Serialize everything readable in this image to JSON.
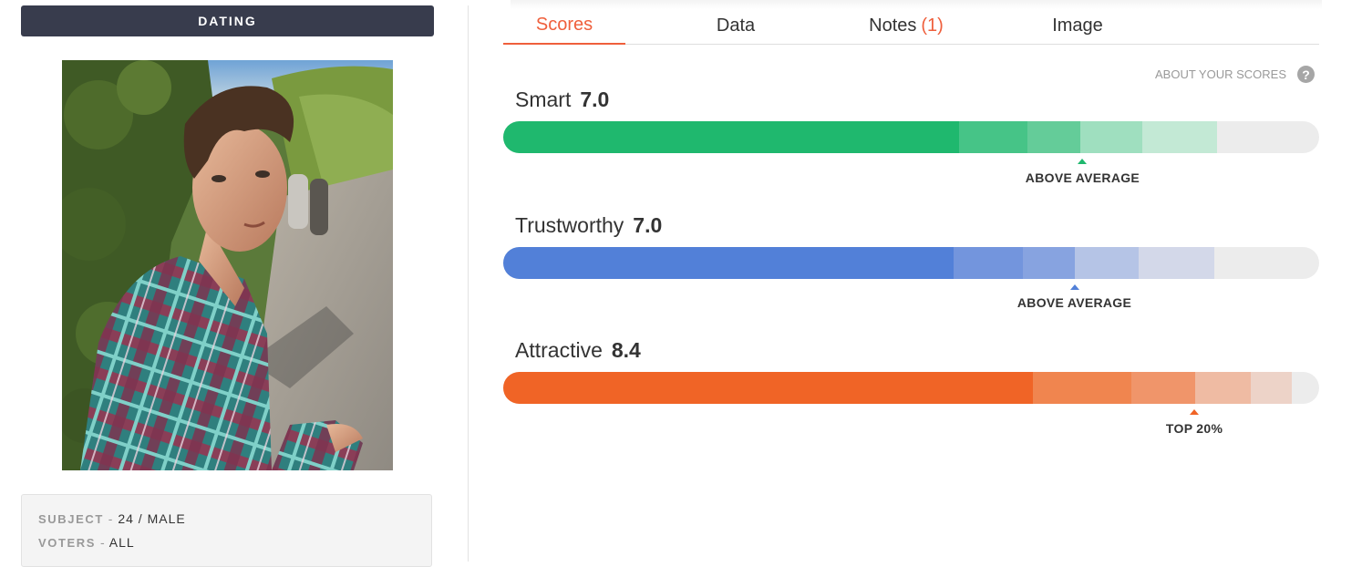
{
  "category": "DATING",
  "subject": {
    "label": "SUBJECT",
    "value": "24 / MALE"
  },
  "voters": {
    "label": "VOTERS",
    "value": "ALL"
  },
  "separator": "-",
  "tabs": [
    {
      "label": "Scores",
      "active": true
    },
    {
      "label": "Data",
      "active": false
    },
    {
      "label": "Notes",
      "count": "(1)",
      "active": false
    },
    {
      "label": "Image",
      "active": false
    }
  ],
  "about_label": "ABOUT YOUR SCORES",
  "help_icon": "question-circle-icon",
  "scores": [
    {
      "name": "Smart",
      "value": "7.0",
      "marker_label": "ABOVE AVERAGE",
      "marker_position": 0.71,
      "color": "#1fb86e",
      "segments": [
        {
          "end": 0.559,
          "color": "#1fb86e"
        },
        {
          "end": 0.643,
          "color": "#46c487"
        },
        {
          "end": 0.707,
          "color": "#64cc99"
        },
        {
          "end": 0.783,
          "color": "#9fdfbf"
        },
        {
          "end": 0.875,
          "color": "#c3e9d5"
        }
      ]
    },
    {
      "name": "Trustworthy",
      "value": "7.0",
      "marker_label": "ABOVE AVERAGE",
      "marker_position": 0.7,
      "color": "#5280d8",
      "segments": [
        {
          "end": 0.552,
          "color": "#5280d8"
        },
        {
          "end": 0.637,
          "color": "#7395dd"
        },
        {
          "end": 0.701,
          "color": "#87a3e0"
        },
        {
          "end": 0.779,
          "color": "#b5c4e6"
        },
        {
          "end": 0.871,
          "color": "#d3d8e9"
        }
      ]
    },
    {
      "name": "Attractive",
      "value": "8.4",
      "marker_label": "TOP 20%",
      "marker_position": 0.847,
      "color": "#f06426",
      "segments": [
        {
          "end": 0.649,
          "color": "#f06426"
        },
        {
          "end": 0.77,
          "color": "#f0854f"
        },
        {
          "end": 0.848,
          "color": "#f0956a"
        },
        {
          "end": 0.916,
          "color": "#efbba3"
        },
        {
          "end": 0.967,
          "color": "#edd3c8"
        }
      ]
    }
  ]
}
